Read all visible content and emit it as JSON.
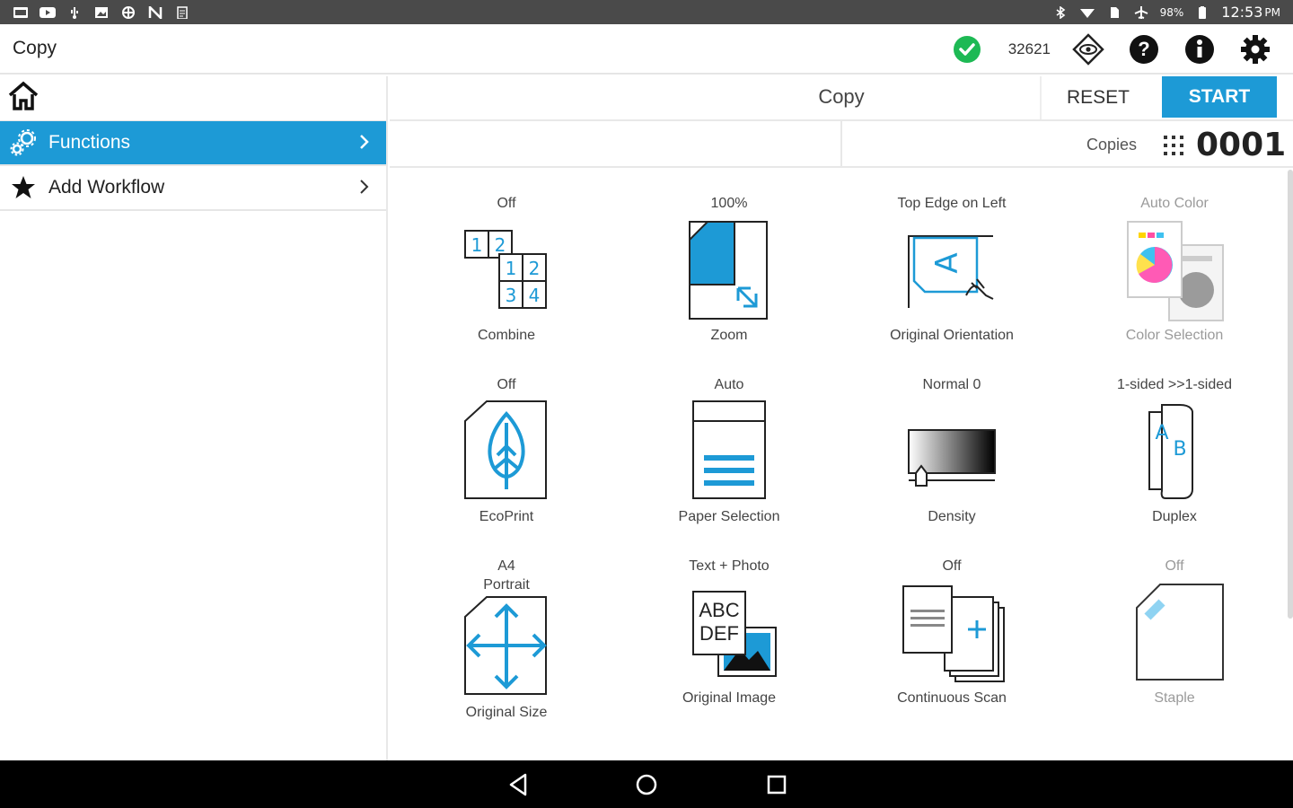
{
  "status_bar": {
    "time": "12:53",
    "ampm": "PM",
    "battery": "98%",
    "left_icons": [
      "gallery-icon",
      "youtube-icon",
      "usb-icon",
      "image-icon",
      "vpn-icon",
      "nfc-icon",
      "clipboard-icon"
    ],
    "right_icons": [
      "bluetooth-icon",
      "wifi-icon",
      "sim-icon",
      "airplane-icon",
      "battery-icon"
    ]
  },
  "app_bar": {
    "title": "Copy",
    "status_color": "#1db954",
    "counter": "32621",
    "icons": [
      "status-ok-icon",
      "eye-icon",
      "help-icon",
      "info-icon",
      "settings-icon"
    ]
  },
  "left_menu": {
    "home_icon": "home-icon",
    "items": [
      {
        "label": "Functions",
        "icon": "gears-icon",
        "active": true
      },
      {
        "label": "Add Workflow",
        "icon": "star-icon",
        "active": false
      }
    ]
  },
  "job_header": {
    "title": "Copy",
    "reset_label": "RESET",
    "start_label": "START",
    "accent_color": "#1d9ad6"
  },
  "copies": {
    "label": "Copies",
    "value": "0001"
  },
  "functions": [
    {
      "value": "Off",
      "label": "Combine",
      "icon": "combine-icon"
    },
    {
      "value": "100%",
      "label": "Zoom",
      "icon": "zoom-icon"
    },
    {
      "value": "Top Edge on Left",
      "label": "Original Orientation",
      "icon": "orientation-icon"
    },
    {
      "value": "Auto Color",
      "label": "Color Selection",
      "icon": "color-selection-icon",
      "disabled": true
    },
    {
      "value": "Off",
      "label": "EcoPrint",
      "icon": "ecoprint-icon"
    },
    {
      "value": "Auto",
      "label": "Paper Selection",
      "icon": "paper-selection-icon"
    },
    {
      "value": "Normal 0",
      "label": "Density",
      "icon": "density-icon"
    },
    {
      "value": "1-sided >>1-sided",
      "label": "Duplex",
      "icon": "duplex-icon"
    },
    {
      "value": "A4",
      "value2": "Portrait",
      "label": "Original Size",
      "icon": "original-size-icon"
    },
    {
      "value": "Text + Photo",
      "label": "Original Image",
      "icon": "original-image-icon"
    },
    {
      "value": "Off",
      "label": "Continuous Scan",
      "icon": "continuous-scan-icon"
    },
    {
      "value": "Off",
      "label": "Staple",
      "icon": "staple-icon",
      "disabled": true
    }
  ],
  "icon_text": {
    "combine": [
      "1",
      "2",
      "1",
      "2",
      "3",
      "4"
    ],
    "orientation_letter": "A",
    "duplex": [
      "A",
      "B"
    ],
    "abc": "ABC",
    "def": "DEF"
  },
  "nav_bar": {
    "icons": [
      "back-icon",
      "home-circle-icon",
      "recents-icon"
    ]
  }
}
